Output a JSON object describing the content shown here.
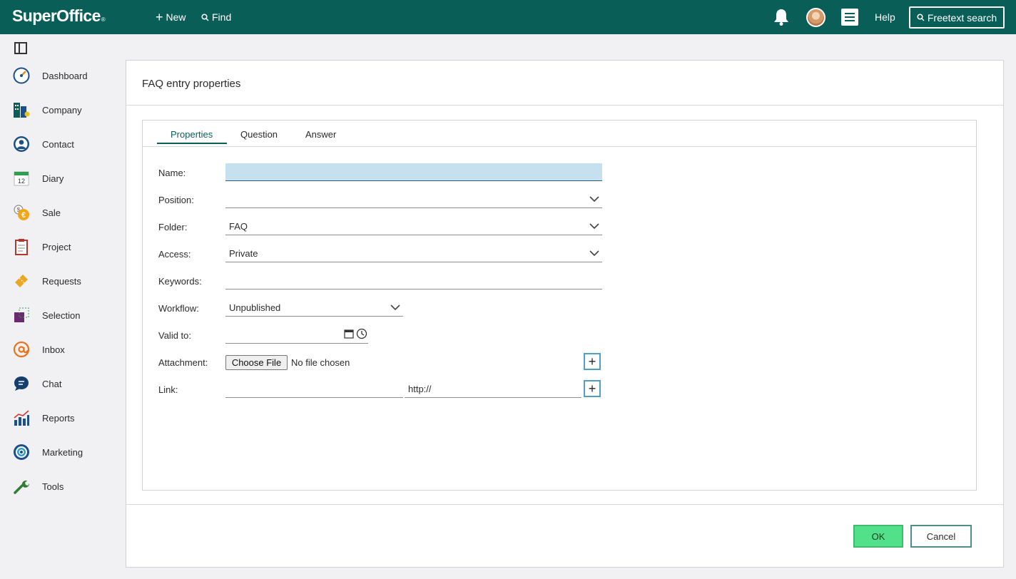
{
  "topbar": {
    "logo": "SuperOffice",
    "logo_mark": "®",
    "new_label": "New",
    "find_label": "Find",
    "help_label": "Help",
    "freetext_label": "Freetext search",
    "icons": [
      "bell-icon",
      "user-avatar",
      "menu-icon",
      "search-icon",
      "plus-icon"
    ]
  },
  "sidebar": {
    "items": [
      {
        "label": "Dashboard",
        "icon": "dashboard-gauge-icon"
      },
      {
        "label": "Company",
        "icon": "company-building-icon"
      },
      {
        "label": "Contact",
        "icon": "contact-person-icon"
      },
      {
        "label": "Diary",
        "icon": "diary-calendar-icon"
      },
      {
        "label": "Sale",
        "icon": "sale-coins-icon"
      },
      {
        "label": "Project",
        "icon": "project-clipboard-icon"
      },
      {
        "label": "Requests",
        "icon": "requests-ticket-icon"
      },
      {
        "label": "Selection",
        "icon": "selection-icon"
      },
      {
        "label": "Inbox",
        "icon": "inbox-at-icon"
      },
      {
        "label": "Chat",
        "icon": "chat-bubble-icon"
      },
      {
        "label": "Reports",
        "icon": "reports-chart-icon"
      },
      {
        "label": "Marketing",
        "icon": "marketing-target-icon"
      },
      {
        "label": "Tools",
        "icon": "tools-wrench-icon"
      }
    ],
    "diary_day": "12"
  },
  "dialog": {
    "title": "FAQ entry properties",
    "tabs": [
      {
        "label": "Properties",
        "active": true
      },
      {
        "label": "Question",
        "active": false
      },
      {
        "label": "Answer",
        "active": false
      }
    ],
    "fields": {
      "name": {
        "label": "Name:",
        "value": ""
      },
      "position": {
        "label": "Position:",
        "value": ""
      },
      "folder": {
        "label": "Folder:",
        "value": "FAQ"
      },
      "access": {
        "label": "Access:",
        "value": "Private"
      },
      "keywords": {
        "label": "Keywords:",
        "value": ""
      },
      "workflow": {
        "label": "Workflow:",
        "value": "Unpublished"
      },
      "valid_to": {
        "label": "Valid to:",
        "value": ""
      },
      "attachment": {
        "label": "Attachment:",
        "button": "Choose File",
        "status": "No file chosen"
      },
      "link": {
        "label": "Link:",
        "title_value": "",
        "url_value": "http://"
      }
    },
    "ok_label": "OK",
    "cancel_label": "Cancel"
  },
  "colors": {
    "brand": "#0a5e58",
    "name_input_bg": "#c6e0f0",
    "ok_green": "#52e18a",
    "plus_border": "#4f9fc9"
  }
}
